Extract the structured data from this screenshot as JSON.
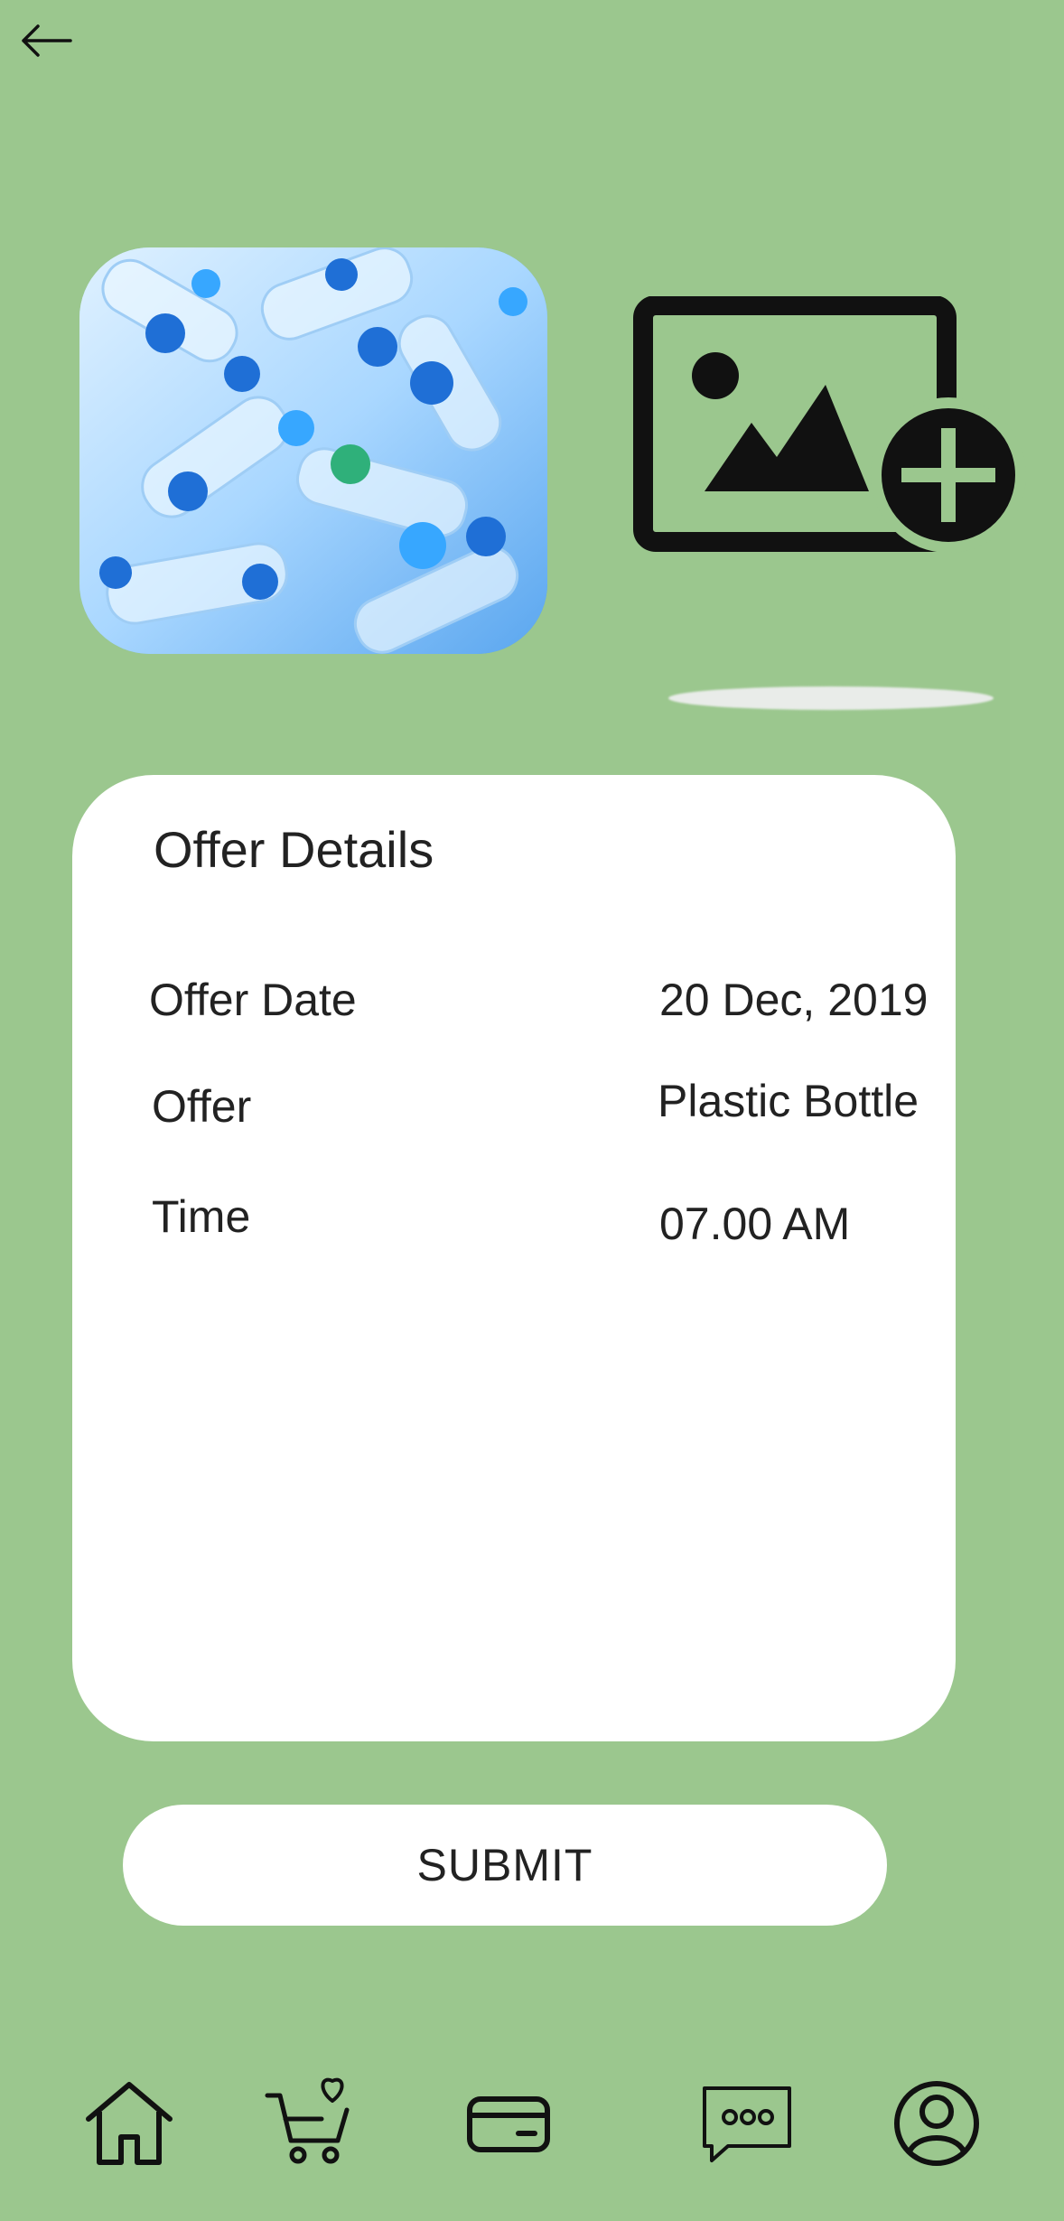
{
  "colors": {
    "background": "#9bc78e",
    "card": "#ffffff",
    "icon": "#111111"
  },
  "header": {
    "back_icon": "arrow-left-icon"
  },
  "media": {
    "photo_icon": "plastic-bottles-photo",
    "add_image_icon": "add-image-icon"
  },
  "offer_details": {
    "title": "Offer Details",
    "rows": [
      {
        "label": "Offer Date",
        "value": "20 Dec, 2019"
      },
      {
        "label": "Offer",
        "value": "Plastic Bottle"
      },
      {
        "label": "Time",
        "value": "07.00 AM"
      }
    ]
  },
  "actions": {
    "submit_label": "SUBMIT"
  },
  "bottom_nav": {
    "items": [
      {
        "icon": "home-icon"
      },
      {
        "icon": "cart-heart-icon"
      },
      {
        "icon": "credit-card-icon"
      },
      {
        "icon": "chat-bubble-icon"
      },
      {
        "icon": "profile-icon"
      }
    ]
  }
}
